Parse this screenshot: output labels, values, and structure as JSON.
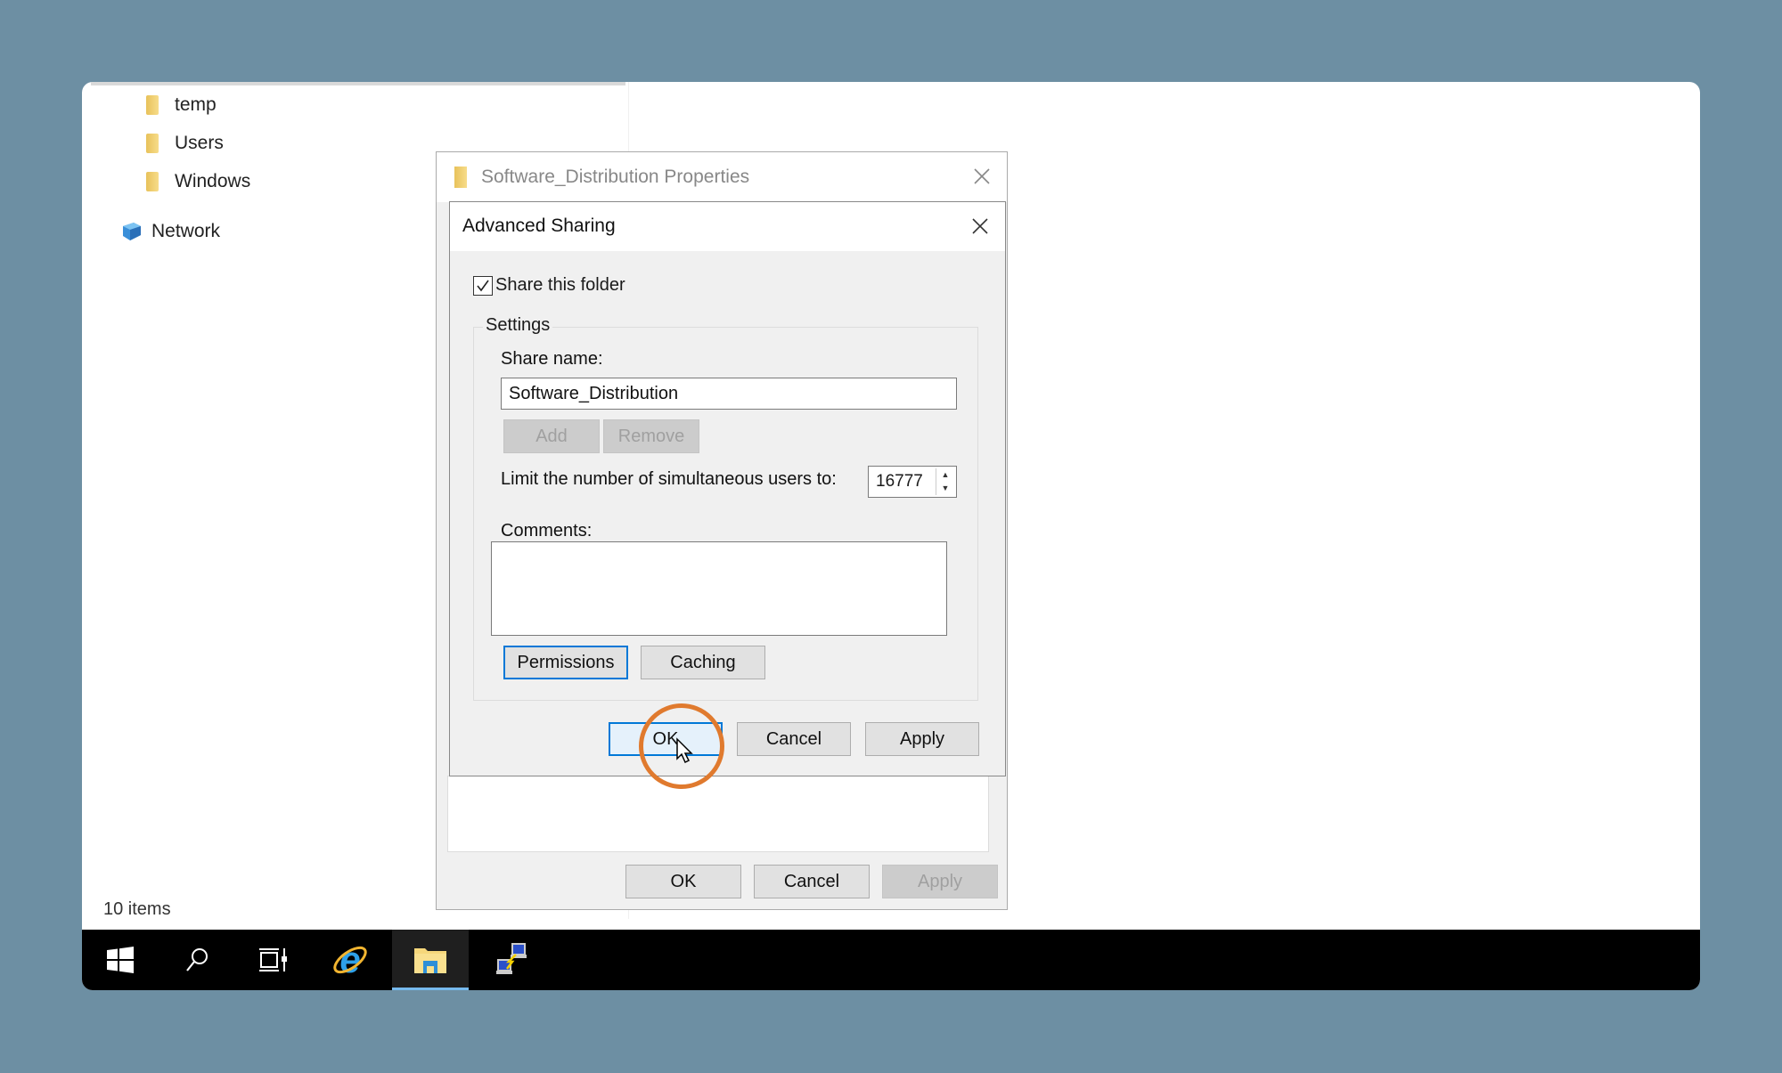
{
  "explorer": {
    "tree": [
      {
        "label": "temp",
        "icon": "folder-icon"
      },
      {
        "label": "Users",
        "icon": "folder-icon"
      },
      {
        "label": "Windows",
        "icon": "folder-icon"
      },
      {
        "label": "Network",
        "icon": "network-icon"
      }
    ],
    "status": "10 items"
  },
  "taskbar": {
    "items": [
      {
        "name": "start",
        "icon": "windows-logo-icon"
      },
      {
        "name": "search",
        "icon": "search-icon"
      },
      {
        "name": "task-view",
        "icon": "task-view-icon"
      },
      {
        "name": "internet-explorer",
        "icon": "internet-explorer-icon"
      },
      {
        "name": "file-explorer",
        "icon": "file-explorer-icon",
        "active": true
      },
      {
        "name": "network-connections",
        "icon": "network-computers-icon"
      }
    ]
  },
  "properties_dialog": {
    "title": "Software_Distribution Properties",
    "buttons": {
      "ok": "OK",
      "cancel": "Cancel",
      "apply": "Apply"
    }
  },
  "advanced_sharing": {
    "title": "Advanced Sharing",
    "share_checkbox_label": "Share this folder",
    "share_checked": true,
    "settings_label": "Settings",
    "share_name_label": "Share name:",
    "share_name_value": "Software_Distribution",
    "add_label": "Add",
    "remove_label": "Remove",
    "limit_label": "Limit the number of simultaneous users to:",
    "limit_value": "16777",
    "comments_label": "Comments:",
    "comments_value": "",
    "permissions_label": "Permissions",
    "caching_label": "Caching",
    "buttons": {
      "ok": "OK",
      "cancel": "Cancel",
      "apply": "Apply"
    }
  },
  "highlight": {
    "target": "advanced-sharing-ok-button",
    "color": "#e07a2e"
  }
}
